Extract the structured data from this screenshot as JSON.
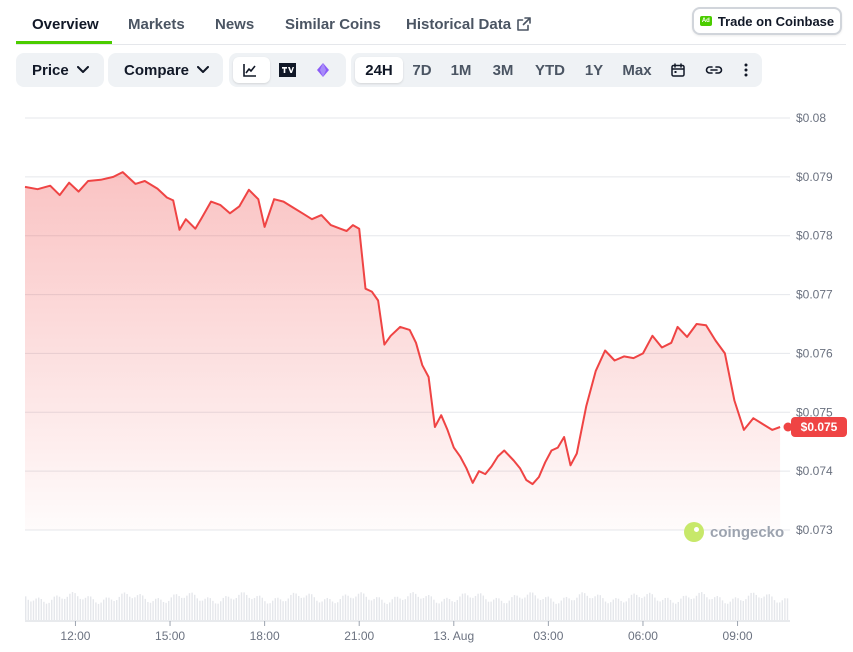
{
  "tabs": [
    {
      "label": "Overview",
      "active": true
    },
    {
      "label": "Markets"
    },
    {
      "label": "News"
    },
    {
      "label": "Similar Coins"
    },
    {
      "label": "Historical Data",
      "icon": "external-link-icon"
    }
  ],
  "ad_button": {
    "badge": "Ad",
    "label": "Trade on Coinbase"
  },
  "toolbar": {
    "price_label": "Price",
    "compare_label": "Compare",
    "chart_type_icons": [
      "line-chart-icon",
      "tradingview-icon",
      "diamond-icon"
    ],
    "ranges": [
      "24H",
      "7D",
      "1M",
      "3M",
      "YTD",
      "1Y",
      "Max"
    ],
    "active_range": "24H",
    "extra_icons": [
      "calendar-icon",
      "link-icon",
      "more-icon"
    ]
  },
  "watermark": "coingecko",
  "colors": {
    "line": "#ef4444",
    "accent": "#4bcc00",
    "grid": "#e5e7eb"
  },
  "chart_data": {
    "type": "area",
    "title": "",
    "xlabel": "",
    "ylabel": "",
    "y_ticks": [
      "$0.08",
      "$0.079",
      "$0.078",
      "$0.077",
      "$0.076",
      "$0.075",
      "$0.074",
      "$0.073"
    ],
    "y_tick_values": [
      0.08,
      0.079,
      0.078,
      0.077,
      0.076,
      0.075,
      0.074,
      0.073
    ],
    "ylim": [
      0.073,
      0.08
    ],
    "x_ticks": [
      "12:00",
      "15:00",
      "18:00",
      "21:00",
      "13. Aug",
      "03:00",
      "06:00",
      "09:00"
    ],
    "x_tick_hours": [
      12,
      15,
      18,
      21,
      24,
      27,
      30,
      33
    ],
    "xlim_hours": [
      10.4,
      34.6
    ],
    "current_price_label": "$0.075",
    "current_price": 0.07475,
    "grid": true,
    "series": [
      {
        "x_hours": [
          10.4,
          10.8,
          11.2,
          11.5,
          11.8,
          12.1,
          12.4,
          12.8,
          13.2,
          13.5,
          13.9,
          14.2,
          14.6,
          14.9,
          15.1,
          15.3,
          15.5,
          15.8,
          16.0,
          16.3,
          16.6,
          16.9,
          17.2,
          17.5,
          17.8,
          18.0,
          18.3,
          18.6,
          18.9,
          19.2,
          19.5,
          19.8,
          20.1,
          20.4,
          20.6,
          20.8,
          21.0,
          21.2,
          21.4,
          21.6,
          21.8,
          22.0,
          22.3,
          22.6,
          22.8,
          23.0,
          23.2,
          23.4,
          23.6,
          23.8,
          24.0,
          24.2,
          24.4,
          24.6,
          24.8,
          25.0,
          25.2,
          25.4,
          25.6,
          25.9,
          26.1,
          26.3,
          26.5,
          26.7,
          26.9,
          27.1,
          27.3,
          27.5,
          27.7,
          27.9,
          28.2,
          28.5,
          28.8,
          29.1,
          29.4,
          29.7,
          30.0,
          30.3,
          30.6,
          30.9,
          31.1,
          31.4,
          31.7,
          32.0,
          32.3,
          32.6,
          32.9,
          33.2,
          33.5,
          33.8,
          34.1,
          34.35
        ],
        "values": [
          0.07883,
          0.07879,
          0.07885,
          0.07869,
          0.0789,
          0.07875,
          0.07893,
          0.07895,
          0.079,
          0.07908,
          0.07888,
          0.07893,
          0.0788,
          0.07865,
          0.0786,
          0.0781,
          0.07828,
          0.07812,
          0.0783,
          0.07858,
          0.07852,
          0.07838,
          0.0785,
          0.07878,
          0.07862,
          0.07815,
          0.07862,
          0.07858,
          0.07848,
          0.07838,
          0.07828,
          0.07835,
          0.07818,
          0.07812,
          0.07808,
          0.07818,
          0.07812,
          0.0771,
          0.07705,
          0.0769,
          0.07615,
          0.0763,
          0.07645,
          0.0764,
          0.07618,
          0.0758,
          0.0756,
          0.07475,
          0.07495,
          0.0747,
          0.0744,
          0.07425,
          0.07405,
          0.0738,
          0.074,
          0.07395,
          0.07408,
          0.07425,
          0.07435,
          0.07418,
          0.07405,
          0.07385,
          0.07378,
          0.0739,
          0.07415,
          0.07435,
          0.0744,
          0.07458,
          0.0741,
          0.0743,
          0.0751,
          0.0757,
          0.07605,
          0.07588,
          0.07595,
          0.07592,
          0.076,
          0.0763,
          0.0761,
          0.07618,
          0.07645,
          0.07628,
          0.0765,
          0.07648,
          0.07622,
          0.076,
          0.0752,
          0.0747,
          0.0749,
          0.0748,
          0.0747,
          0.07475
        ]
      }
    ]
  }
}
